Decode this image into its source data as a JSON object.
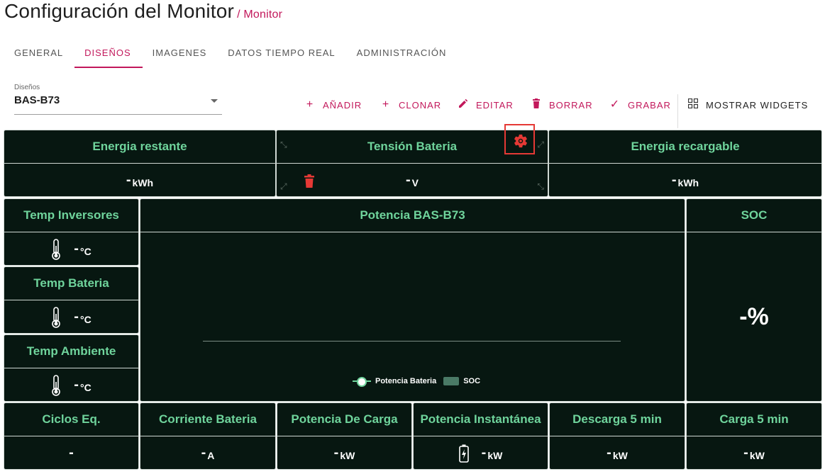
{
  "header": {
    "title": "Configuración del Monitor",
    "crumb": "/ Monitor"
  },
  "tabs": [
    {
      "label": "GENERAL",
      "active": false
    },
    {
      "label": "DISEÑOS",
      "active": true
    },
    {
      "label": "IMAGENES",
      "active": false
    },
    {
      "label": "DATOS TIEMPO REAL",
      "active": false
    },
    {
      "label": "ADMINISTRACIÓN",
      "active": false
    }
  ],
  "designs": {
    "label": "Diseños",
    "value": "BAS-B73"
  },
  "toolbar": {
    "add": "AÑADIR",
    "clone": "CLONAR",
    "edit": "EDITAR",
    "delete": "BORRAR",
    "save": "GRABAR",
    "widgets": "MOSTRAR WIDGETS"
  },
  "widgets": {
    "energia_restante": {
      "title": "Energia restante",
      "value": "-",
      "unit": "kWh"
    },
    "tension_bateria": {
      "title": "Tensión Bateria",
      "value": "-",
      "unit": "V"
    },
    "energia_recargable": {
      "title": "Energia recargable",
      "value": "-",
      "unit": "kWh"
    },
    "temp_inversores": {
      "title": "Temp Inversores",
      "value": "-",
      "unit": "°C"
    },
    "temp_bateria": {
      "title": "Temp Bateria",
      "value": "-",
      "unit": "°C"
    },
    "temp_ambiente": {
      "title": "Temp Ambiente",
      "value": "-",
      "unit": "°C"
    },
    "potencia_chart": {
      "title": "Potencia BAS-B73",
      "legend_power": "Potencia Bateria",
      "legend_soc": "SOC"
    },
    "soc": {
      "title": "SOC",
      "value": "-%"
    },
    "ciclos": {
      "title": "Ciclos Eq.",
      "value": "-"
    },
    "corriente": {
      "title": "Corriente Bateria",
      "value": "-",
      "unit": "A"
    },
    "potencia_carga": {
      "title": "Potencia De Carga",
      "value": "-",
      "unit": "kW"
    },
    "potencia_instantanea": {
      "title": "Potencia Instantánea",
      "value": "-",
      "unit": "kW"
    },
    "descarga_5": {
      "title": "Descarga 5 min",
      "value": "-",
      "unit": "kW"
    },
    "carga_5": {
      "title": "Carga 5 min",
      "value": "-",
      "unit": "kW"
    }
  },
  "colors": {
    "accent": "#c2185b",
    "panel_bg": "#071711",
    "panel_title": "#6fd49c",
    "highlight": "#e53935"
  },
  "icons": {
    "thermometer": "thermometer-icon",
    "battery": "battery-charging-icon",
    "gear": "gear-icon",
    "trash": "trash-icon",
    "widgets": "grid-icon"
  }
}
